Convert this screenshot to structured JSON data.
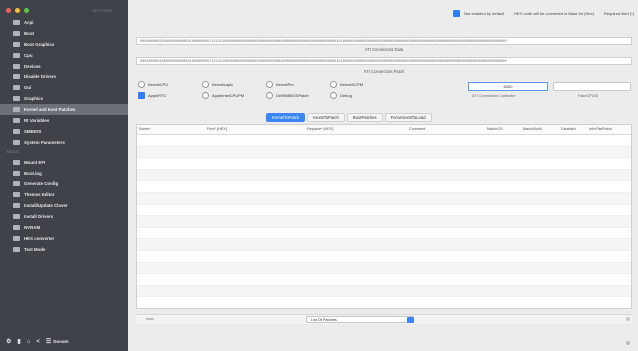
{
  "sidebar": {
    "header": "SECTIONS",
    "items": [
      {
        "label": "Acpi"
      },
      {
        "label": "Boot"
      },
      {
        "label": "Boot Graphics"
      },
      {
        "label": "Cpu"
      },
      {
        "label": "Devices"
      },
      {
        "label": "Disable Drivers"
      },
      {
        "label": "Gui"
      },
      {
        "label": "Graphics"
      },
      {
        "label": "Kernel and Kext Patches",
        "selected": true
      },
      {
        "label": "Rt Variables"
      },
      {
        "label": "SMBIOS"
      },
      {
        "label": "System Parameters"
      }
    ],
    "tools_header": "TOOLS",
    "tools": [
      {
        "label": "Mount EFI"
      },
      {
        "label": "Boot.log"
      },
      {
        "label": "Generate Config"
      },
      {
        "label": "Themes Editor"
      },
      {
        "label": "Install/Update Clover"
      },
      {
        "label": "Install Drivers"
      },
      {
        "label": "NVRAM"
      },
      {
        "label": "HEX converter"
      },
      {
        "label": "Text Mode"
      }
    ],
    "bottom_donate": "Donate"
  },
  "topbar": {
    "not_enabled_label": "Not enabled by default",
    "hex_note": "HEX code will be converted in Base 64 (Hex)",
    "required_field": "Required field (*)"
  },
  "ati": {
    "field1": "00040000030400000000000100000000712222100000000000000003000000000400000000000000000000000001010000040000000000400000000000000000000000000000000000000000000000000000000000",
    "caption1": "ATI Connectors Data",
    "field2": "00040000040000000000000100000000712222100000000000000003000000000400000000000000000000000001010000040000000000400000000000000000000000000000000000000000000000000000000000",
    "caption2": "ATI Connectors Patch"
  },
  "options": {
    "row1": [
      "KernelCPU",
      "KernelLapic",
      "KernelPm",
      "KernelXCPM"
    ],
    "row2": [
      "AppleRTC",
      "AppleIntelCPUPM",
      "DellSMBIOSPatch",
      "Debug"
    ],
    "row2_checked": [
      true,
      false,
      false,
      false
    ]
  },
  "connector": {
    "value": "6000",
    "label": "ATI Connectors Controller",
    "fake_label": "FakeCPUID"
  },
  "tabs": [
    "KernelToPatch",
    "KextsToPatch",
    "BootPatches",
    "ForceKextsToLoad"
  ],
  "table": {
    "columns": [
      "Name*",
      "Find* [HEX]",
      "Replace* [HEX]",
      "Comment",
      "MatchOS",
      "MatchBuild",
      "Disabled",
      "InfoPlistPatch"
    ]
  },
  "footer": {
    "popup": "List Of Patches"
  },
  "colors": {
    "accent": "#3b86f7",
    "sidebar": "#3f4349"
  }
}
